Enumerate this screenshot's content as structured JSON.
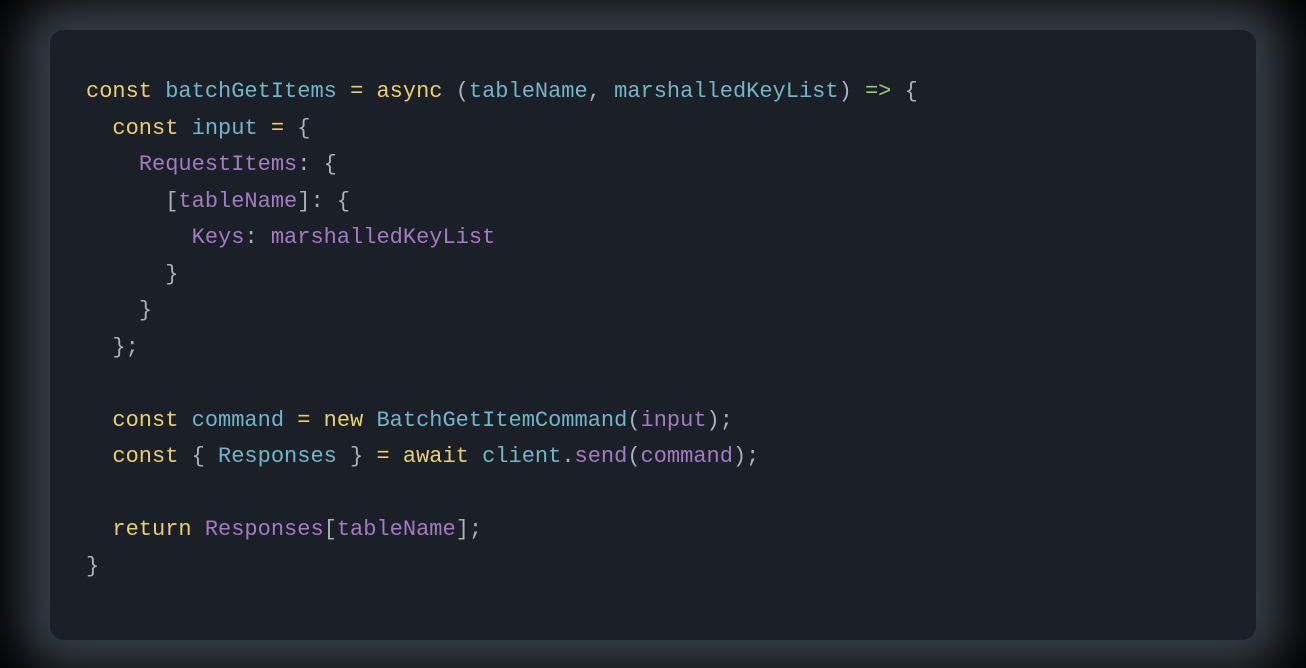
{
  "code": {
    "language": "javascript",
    "tokens": [
      [
        {
          "t": "const ",
          "c": "tok-keyword"
        },
        {
          "t": "batchGetItems",
          "c": "tok-funcname"
        },
        {
          "t": " ",
          "c": "tok-punct"
        },
        {
          "t": "=",
          "c": "tok-operator"
        },
        {
          "t": " ",
          "c": "tok-punct"
        },
        {
          "t": "async",
          "c": "tok-keyword"
        },
        {
          "t": " ",
          "c": "tok-punct"
        },
        {
          "t": "(",
          "c": "tok-punct"
        },
        {
          "t": "tableName",
          "c": "tok-param"
        },
        {
          "t": ", ",
          "c": "tok-punct"
        },
        {
          "t": "marshalledKeyList",
          "c": "tok-param"
        },
        {
          "t": ")",
          "c": "tok-punct"
        },
        {
          "t": " ",
          "c": "tok-punct"
        },
        {
          "t": "=>",
          "c": "tok-arrow"
        },
        {
          "t": " ",
          "c": "tok-punct"
        },
        {
          "t": "{",
          "c": "tok-punct"
        }
      ],
      [
        {
          "t": "  ",
          "c": "tok-punct"
        },
        {
          "t": "const ",
          "c": "tok-keyword"
        },
        {
          "t": "input",
          "c": "tok-var"
        },
        {
          "t": " ",
          "c": "tok-punct"
        },
        {
          "t": "=",
          "c": "tok-operator"
        },
        {
          "t": " ",
          "c": "tok-punct"
        },
        {
          "t": "{",
          "c": "tok-punct"
        }
      ],
      [
        {
          "t": "    ",
          "c": "tok-punct"
        },
        {
          "t": "RequestItems",
          "c": "tok-prop"
        },
        {
          "t": ": ",
          "c": "tok-punct"
        },
        {
          "t": "{",
          "c": "tok-punct"
        }
      ],
      [
        {
          "t": "      ",
          "c": "tok-punct"
        },
        {
          "t": "[",
          "c": "tok-punct"
        },
        {
          "t": "tableName",
          "c": "tok-ident"
        },
        {
          "t": "]",
          "c": "tok-punct"
        },
        {
          "t": ": ",
          "c": "tok-punct"
        },
        {
          "t": "{",
          "c": "tok-punct"
        }
      ],
      [
        {
          "t": "        ",
          "c": "tok-punct"
        },
        {
          "t": "Keys",
          "c": "tok-prop"
        },
        {
          "t": ": ",
          "c": "tok-punct"
        },
        {
          "t": "marshalledKeyList",
          "c": "tok-ident"
        }
      ],
      [
        {
          "t": "      ",
          "c": "tok-punct"
        },
        {
          "t": "}",
          "c": "tok-punct"
        }
      ],
      [
        {
          "t": "    ",
          "c": "tok-punct"
        },
        {
          "t": "}",
          "c": "tok-punct"
        }
      ],
      [
        {
          "t": "  ",
          "c": "tok-punct"
        },
        {
          "t": "};",
          "c": "tok-punct"
        }
      ],
      [
        {
          "t": "",
          "c": "tok-punct"
        }
      ],
      [
        {
          "t": "  ",
          "c": "tok-punct"
        },
        {
          "t": "const ",
          "c": "tok-keyword"
        },
        {
          "t": "command",
          "c": "tok-var"
        },
        {
          "t": " ",
          "c": "tok-punct"
        },
        {
          "t": "=",
          "c": "tok-operator"
        },
        {
          "t": " ",
          "c": "tok-punct"
        },
        {
          "t": "new ",
          "c": "tok-keyword"
        },
        {
          "t": "BatchGetItemCommand",
          "c": "tok-class"
        },
        {
          "t": "(",
          "c": "tok-punct"
        },
        {
          "t": "input",
          "c": "tok-ident"
        },
        {
          "t": ");",
          "c": "tok-punct"
        }
      ],
      [
        {
          "t": "  ",
          "c": "tok-punct"
        },
        {
          "t": "const ",
          "c": "tok-keyword"
        },
        {
          "t": "{ ",
          "c": "tok-punct"
        },
        {
          "t": "Responses",
          "c": "tok-var"
        },
        {
          "t": " } ",
          "c": "tok-punct"
        },
        {
          "t": "=",
          "c": "tok-operator"
        },
        {
          "t": " ",
          "c": "tok-punct"
        },
        {
          "t": "await ",
          "c": "tok-keyword"
        },
        {
          "t": "client",
          "c": "tok-funcname"
        },
        {
          "t": ".",
          "c": "tok-punct"
        },
        {
          "t": "send",
          "c": "tok-prop"
        },
        {
          "t": "(",
          "c": "tok-punct"
        },
        {
          "t": "command",
          "c": "tok-ident"
        },
        {
          "t": ");",
          "c": "tok-punct"
        }
      ],
      [
        {
          "t": "",
          "c": "tok-punct"
        }
      ],
      [
        {
          "t": "  ",
          "c": "tok-punct"
        },
        {
          "t": "return ",
          "c": "tok-keyword"
        },
        {
          "t": "Responses",
          "c": "tok-prop"
        },
        {
          "t": "[",
          "c": "tok-punct"
        },
        {
          "t": "tableName",
          "c": "tok-ident"
        },
        {
          "t": "];",
          "c": "tok-punct"
        }
      ],
      [
        {
          "t": "}",
          "c": "tok-punct"
        }
      ]
    ]
  }
}
